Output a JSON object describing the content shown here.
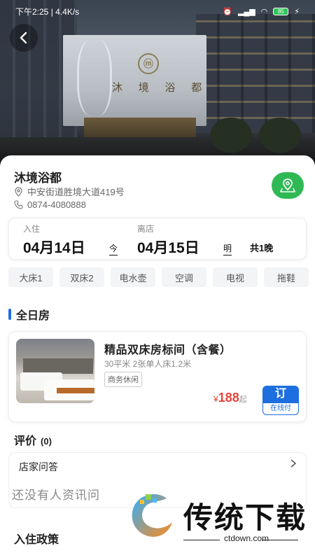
{
  "status_bar": {
    "time": "下午2:25",
    "speed": "4.4K/s",
    "battery": "85"
  },
  "hotel": {
    "name": "沐境浴都",
    "address": "中安街道胜境大道419号",
    "phone": "0874-4080888",
    "sign_text": "沐 境 浴 都"
  },
  "dates": {
    "checkin_label": "入住",
    "checkin_date": "04月14日",
    "checkin_suffix": "今",
    "checkout_label": "离店",
    "checkout_date": "04月15日",
    "checkout_suffix": "明",
    "nights": "共1晚"
  },
  "amenities": [
    "大床1",
    "双床2",
    "电水壶",
    "空调",
    "电视",
    "拖鞋"
  ],
  "section_all_day": "全日房",
  "room": {
    "title": "精品双床房标间（含餐）",
    "subtitle": "30平米 2张单人床1.2米",
    "tag": "商务休闲",
    "price_symbol": "¥",
    "price": "188",
    "price_unit": "起",
    "book_label": "订",
    "book_sub": "在线付"
  },
  "reviews": {
    "title": "评价",
    "count": "(0)"
  },
  "qa": {
    "title": "店家问答",
    "empty": "还没有人资讯问"
  },
  "policy_title": "入住政策",
  "watermark": {
    "text": "传统下载",
    "url": "ctdown.com"
  },
  "colors": {
    "accent": "#1d6fe0",
    "price": "#e2453c",
    "map": "#2fb955"
  }
}
